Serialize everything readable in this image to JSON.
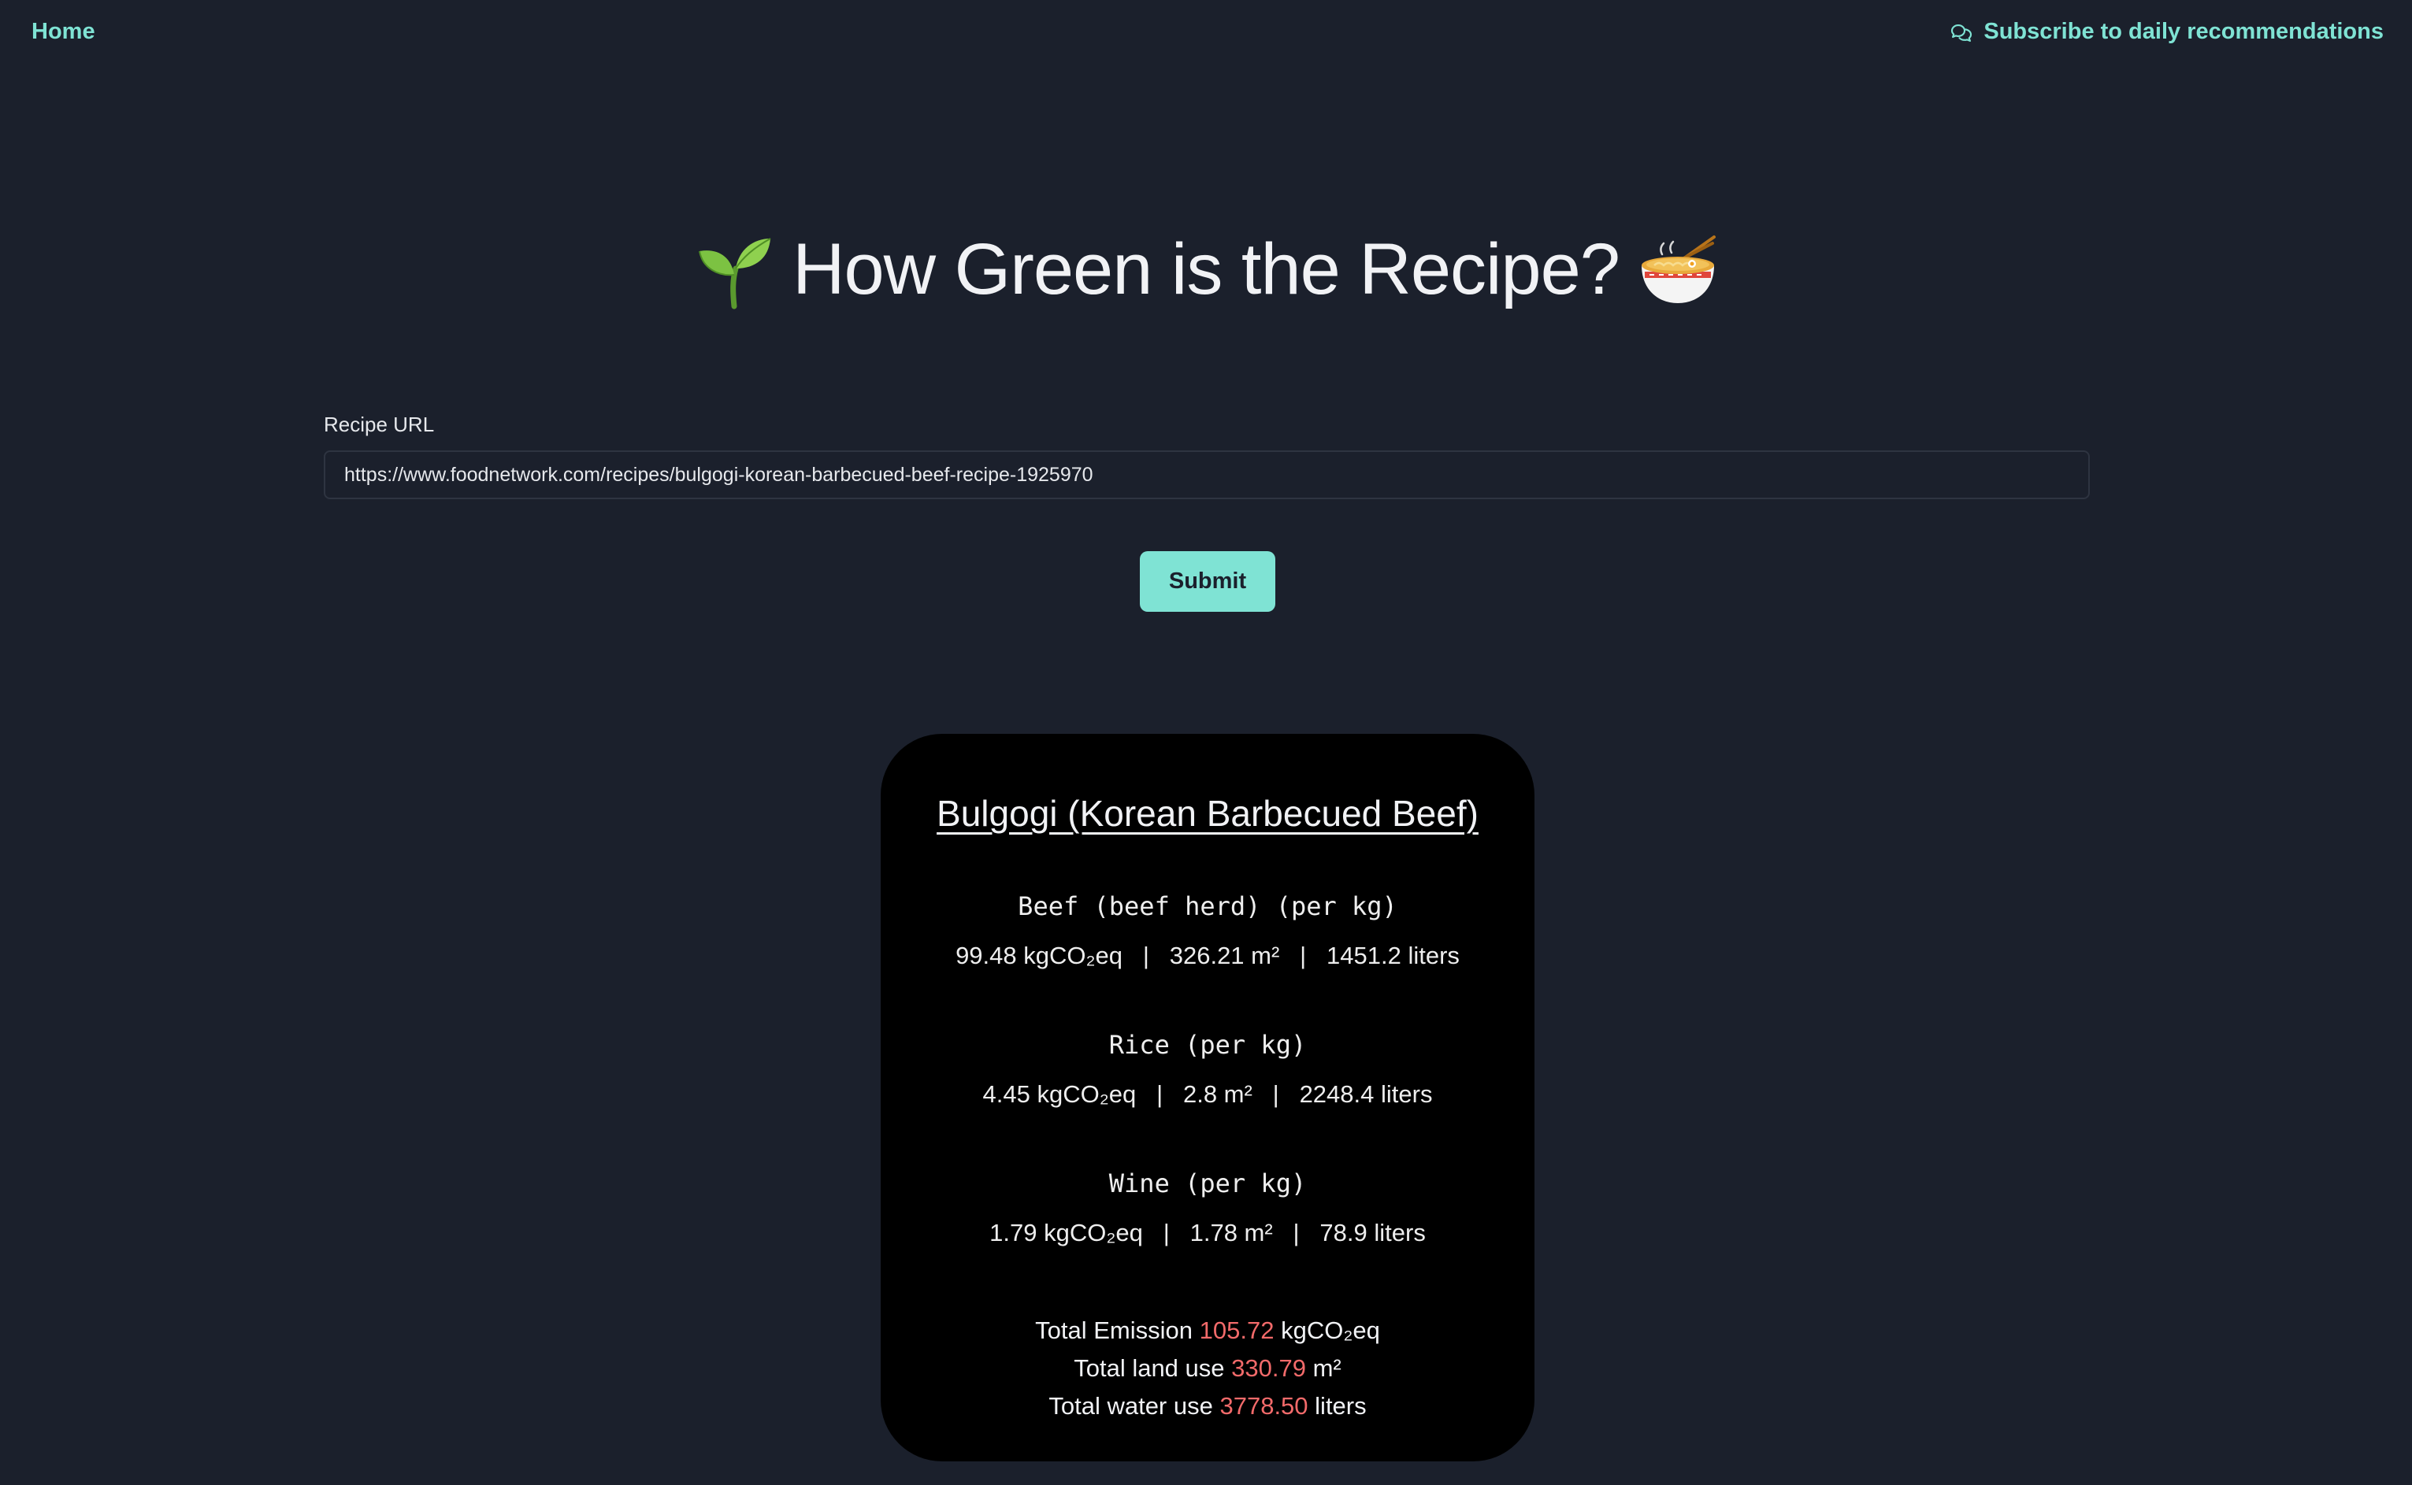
{
  "nav": {
    "home_label": "Home",
    "subscribe_label": "Subscribe to daily recommendations",
    "subscribe_icon": "chat-bubbles-icon"
  },
  "header": {
    "title": "How Green is the Recipe?",
    "left_emoji": "seedling-icon",
    "right_emoji": "noodle-bowl-icon"
  },
  "form": {
    "url_label": "Recipe URL",
    "url_value": "https://www.foodnetwork.com/recipes/bulgogi-korean-barbecued-beef-recipe-1925970",
    "submit_label": "Submit"
  },
  "result": {
    "recipe_name": "Bulgogi (Korean Barbecued Beef)",
    "ingredients": [
      {
        "name": "Beef (beef herd) (per kg)",
        "stats": "99.48 kgCO₂eq   |   326.21 m²   |   1451.2 liters"
      },
      {
        "name": "Rice (per kg)",
        "stats": "4.45 kgCO₂eq   |   2.8 m²   |   2248.4 liters"
      },
      {
        "name": "Wine (per kg)",
        "stats": "1.79 kgCO₂eq   |   1.78 m²   |   78.9 liters"
      }
    ],
    "totals": {
      "emission_label": "Total Emission",
      "emission_value": "105.72",
      "emission_unit": "kgCO₂eq",
      "land_label": "Total land use",
      "land_value": "330.79",
      "land_unit": "m²",
      "water_label": "Total water use",
      "water_value": "3778.50",
      "water_unit": "liters"
    },
    "highlight_color": "#f26a6a"
  },
  "colors": {
    "background": "#1b202c",
    "accent": "#7fe3d4",
    "card": "#000000"
  }
}
